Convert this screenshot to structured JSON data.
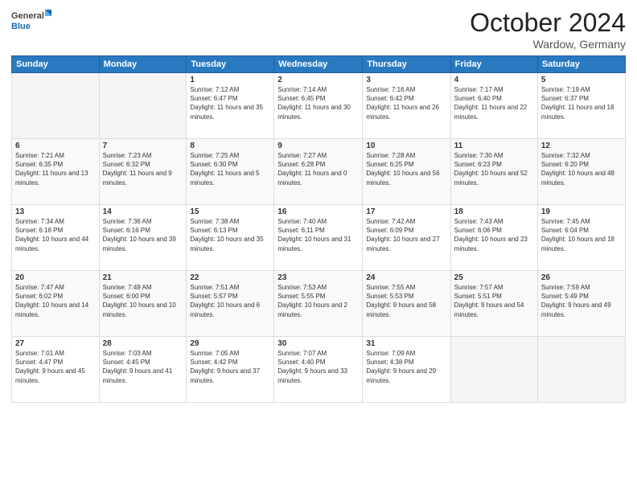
{
  "header": {
    "logo_general": "General",
    "logo_blue": "Blue",
    "month_title": "October 2024",
    "location": "Wardow, Germany"
  },
  "days_of_week": [
    "Sunday",
    "Monday",
    "Tuesday",
    "Wednesday",
    "Thursday",
    "Friday",
    "Saturday"
  ],
  "weeks": [
    [
      {
        "day": "",
        "sunrise": "",
        "sunset": "",
        "daylight": ""
      },
      {
        "day": "",
        "sunrise": "",
        "sunset": "",
        "daylight": ""
      },
      {
        "day": "1",
        "sunrise": "Sunrise: 7:12 AM",
        "sunset": "Sunset: 6:47 PM",
        "daylight": "Daylight: 11 hours and 35 minutes."
      },
      {
        "day": "2",
        "sunrise": "Sunrise: 7:14 AM",
        "sunset": "Sunset: 6:45 PM",
        "daylight": "Daylight: 11 hours and 30 minutes."
      },
      {
        "day": "3",
        "sunrise": "Sunrise: 7:16 AM",
        "sunset": "Sunset: 6:42 PM",
        "daylight": "Daylight: 11 hours and 26 minutes."
      },
      {
        "day": "4",
        "sunrise": "Sunrise: 7:17 AM",
        "sunset": "Sunset: 6:40 PM",
        "daylight": "Daylight: 11 hours and 22 minutes."
      },
      {
        "day": "5",
        "sunrise": "Sunrise: 7:19 AM",
        "sunset": "Sunset: 6:37 PM",
        "daylight": "Daylight: 11 hours and 18 minutes."
      }
    ],
    [
      {
        "day": "6",
        "sunrise": "Sunrise: 7:21 AM",
        "sunset": "Sunset: 6:35 PM",
        "daylight": "Daylight: 11 hours and 13 minutes."
      },
      {
        "day": "7",
        "sunrise": "Sunrise: 7:23 AM",
        "sunset": "Sunset: 6:32 PM",
        "daylight": "Daylight: 11 hours and 9 minutes."
      },
      {
        "day": "8",
        "sunrise": "Sunrise: 7:25 AM",
        "sunset": "Sunset: 6:30 PM",
        "daylight": "Daylight: 11 hours and 5 minutes."
      },
      {
        "day": "9",
        "sunrise": "Sunrise: 7:27 AM",
        "sunset": "Sunset: 6:28 PM",
        "daylight": "Daylight: 11 hours and 0 minutes."
      },
      {
        "day": "10",
        "sunrise": "Sunrise: 7:28 AM",
        "sunset": "Sunset: 6:25 PM",
        "daylight": "Daylight: 10 hours and 56 minutes."
      },
      {
        "day": "11",
        "sunrise": "Sunrise: 7:30 AM",
        "sunset": "Sunset: 6:23 PM",
        "daylight": "Daylight: 10 hours and 52 minutes."
      },
      {
        "day": "12",
        "sunrise": "Sunrise: 7:32 AM",
        "sunset": "Sunset: 6:20 PM",
        "daylight": "Daylight: 10 hours and 48 minutes."
      }
    ],
    [
      {
        "day": "13",
        "sunrise": "Sunrise: 7:34 AM",
        "sunset": "Sunset: 6:18 PM",
        "daylight": "Daylight: 10 hours and 44 minutes."
      },
      {
        "day": "14",
        "sunrise": "Sunrise: 7:36 AM",
        "sunset": "Sunset: 6:16 PM",
        "daylight": "Daylight: 10 hours and 39 minutes."
      },
      {
        "day": "15",
        "sunrise": "Sunrise: 7:38 AM",
        "sunset": "Sunset: 6:13 PM",
        "daylight": "Daylight: 10 hours and 35 minutes."
      },
      {
        "day": "16",
        "sunrise": "Sunrise: 7:40 AM",
        "sunset": "Sunset: 6:11 PM",
        "daylight": "Daylight: 10 hours and 31 minutes."
      },
      {
        "day": "17",
        "sunrise": "Sunrise: 7:42 AM",
        "sunset": "Sunset: 6:09 PM",
        "daylight": "Daylight: 10 hours and 27 minutes."
      },
      {
        "day": "18",
        "sunrise": "Sunrise: 7:43 AM",
        "sunset": "Sunset: 6:06 PM",
        "daylight": "Daylight: 10 hours and 23 minutes."
      },
      {
        "day": "19",
        "sunrise": "Sunrise: 7:45 AM",
        "sunset": "Sunset: 6:04 PM",
        "daylight": "Daylight: 10 hours and 18 minutes."
      }
    ],
    [
      {
        "day": "20",
        "sunrise": "Sunrise: 7:47 AM",
        "sunset": "Sunset: 6:02 PM",
        "daylight": "Daylight: 10 hours and 14 minutes."
      },
      {
        "day": "21",
        "sunrise": "Sunrise: 7:49 AM",
        "sunset": "Sunset: 6:00 PM",
        "daylight": "Daylight: 10 hours and 10 minutes."
      },
      {
        "day": "22",
        "sunrise": "Sunrise: 7:51 AM",
        "sunset": "Sunset: 5:57 PM",
        "daylight": "Daylight: 10 hours and 6 minutes."
      },
      {
        "day": "23",
        "sunrise": "Sunrise: 7:53 AM",
        "sunset": "Sunset: 5:55 PM",
        "daylight": "Daylight: 10 hours and 2 minutes."
      },
      {
        "day": "24",
        "sunrise": "Sunrise: 7:55 AM",
        "sunset": "Sunset: 5:53 PM",
        "daylight": "Daylight: 9 hours and 58 minutes."
      },
      {
        "day": "25",
        "sunrise": "Sunrise: 7:57 AM",
        "sunset": "Sunset: 5:51 PM",
        "daylight": "Daylight: 9 hours and 54 minutes."
      },
      {
        "day": "26",
        "sunrise": "Sunrise: 7:59 AM",
        "sunset": "Sunset: 5:49 PM",
        "daylight": "Daylight: 9 hours and 49 minutes."
      }
    ],
    [
      {
        "day": "27",
        "sunrise": "Sunrise: 7:01 AM",
        "sunset": "Sunset: 4:47 PM",
        "daylight": "Daylight: 9 hours and 45 minutes."
      },
      {
        "day": "28",
        "sunrise": "Sunrise: 7:03 AM",
        "sunset": "Sunset: 4:45 PM",
        "daylight": "Daylight: 9 hours and 41 minutes."
      },
      {
        "day": "29",
        "sunrise": "Sunrise: 7:05 AM",
        "sunset": "Sunset: 4:42 PM",
        "daylight": "Daylight: 9 hours and 37 minutes."
      },
      {
        "day": "30",
        "sunrise": "Sunrise: 7:07 AM",
        "sunset": "Sunset: 4:40 PM",
        "daylight": "Daylight: 9 hours and 33 minutes."
      },
      {
        "day": "31",
        "sunrise": "Sunrise: 7:09 AM",
        "sunset": "Sunset: 4:38 PM",
        "daylight": "Daylight: 9 hours and 29 minutes."
      },
      {
        "day": "",
        "sunrise": "",
        "sunset": "",
        "daylight": ""
      },
      {
        "day": "",
        "sunrise": "",
        "sunset": "",
        "daylight": ""
      }
    ]
  ]
}
